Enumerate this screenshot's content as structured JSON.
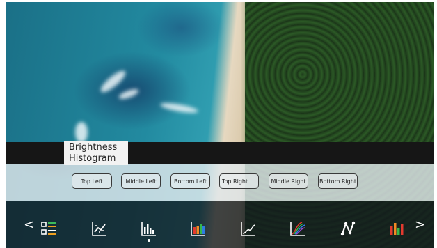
{
  "panel": {
    "title_line1": "Brightness",
    "title_line2": "Histogram"
  },
  "regions": [
    {
      "label": "Top Left"
    },
    {
      "label": "Middle Left"
    },
    {
      "label": "Bottom Left"
    },
    {
      "label": "Top Right"
    },
    {
      "label": "Middle Right"
    },
    {
      "label": "Bottom Right"
    }
  ],
  "dock": {
    "prev_glyph": "<",
    "next_glyph": ">",
    "icons": [
      "list-icon",
      "trend-chart-icon",
      "histogram-icon",
      "color-bar-chart-icon",
      "line-chart-icon",
      "rgb-curves-icon",
      "node-path-icon",
      "rgb-histogram-icon"
    ],
    "active_icon": "histogram-icon"
  },
  "colors": {
    "dock_icon": "#ffffff",
    "list_accent_green": "#3dbb5a",
    "list_accent_orange": "#f0a020",
    "bar_red": "#e23a2f",
    "bar_green": "#35b84a",
    "bar_blue": "#2f7de0",
    "bar_orange": "#f08a24"
  }
}
